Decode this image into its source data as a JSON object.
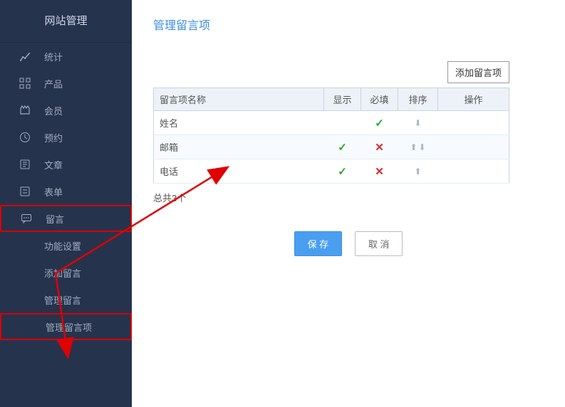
{
  "sidebar": {
    "title": "网站管理",
    "items": [
      {
        "icon": "stats-icon",
        "label": "统计"
      },
      {
        "icon": "product-icon",
        "label": "产品"
      },
      {
        "icon": "member-icon",
        "label": "会员"
      },
      {
        "icon": "booking-icon",
        "label": "预约"
      },
      {
        "icon": "article-icon",
        "label": "文章"
      },
      {
        "icon": "form-icon",
        "label": "表单"
      },
      {
        "icon": "message-icon",
        "label": "留言",
        "highlighted": true
      }
    ],
    "subItems": [
      {
        "label": "功能设置"
      },
      {
        "label": "添加留言"
      },
      {
        "label": "管理留言"
      },
      {
        "label": "管理留言项",
        "highlighted": true
      }
    ]
  },
  "page": {
    "title": "管理留言项",
    "addButton": "添加留言项",
    "columns": {
      "name": "留言项名称",
      "show": "显示",
      "required": "必填",
      "sort": "排序",
      "action": "操作"
    },
    "rows": [
      {
        "name": "姓名",
        "show": "",
        "required": "check",
        "sortUp": false,
        "sortDown": true
      },
      {
        "name": "邮箱",
        "show": "check",
        "required": "cross",
        "sortUp": true,
        "sortDown": true
      },
      {
        "name": "电话",
        "show": "check",
        "required": "cross",
        "sortUp": true,
        "sortDown": false
      }
    ],
    "total": "总共3个",
    "saveButton": "保 存",
    "cancelButton": "取 消"
  }
}
